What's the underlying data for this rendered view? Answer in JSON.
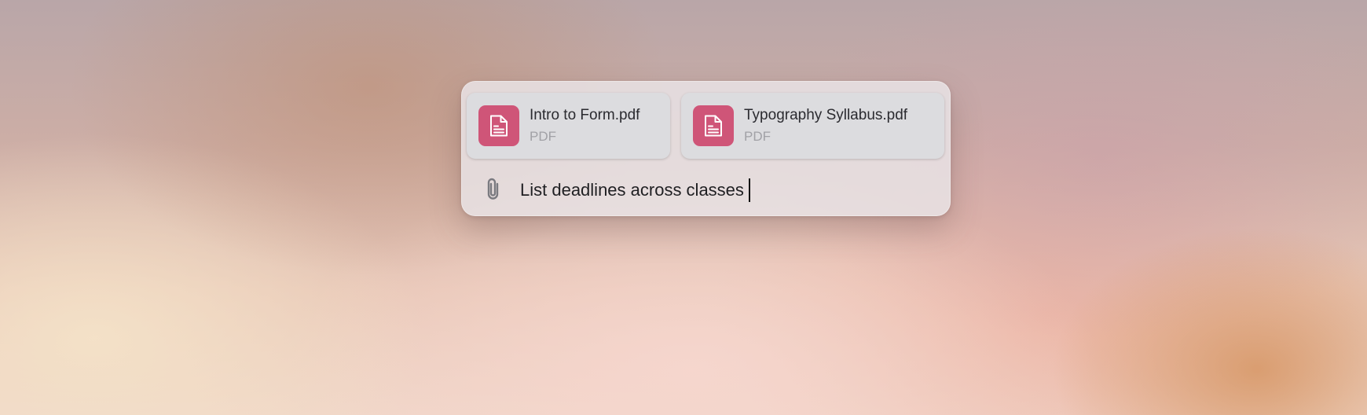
{
  "attachments": [
    {
      "name": "Intro to Form.pdf",
      "type": "PDF",
      "icon": "document-icon",
      "color": "#cf5578"
    },
    {
      "name": "Typography Syllabus.pdf",
      "type": "PDF",
      "icon": "document-icon",
      "color": "#cf5578"
    }
  ],
  "input": {
    "attach_icon": "paperclip-icon",
    "value": "List deadlines across classes"
  }
}
